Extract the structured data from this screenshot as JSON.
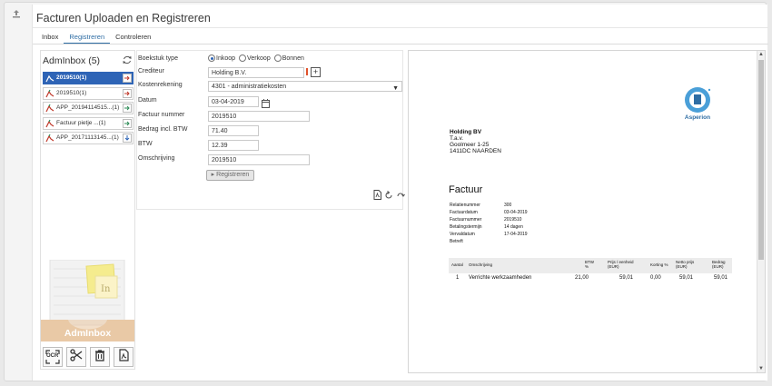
{
  "header": {
    "title": "Facturen Uploaden en Registreren",
    "upload_icon": "upload-icon"
  },
  "tabs": [
    {
      "label": "Inbox",
      "active": false
    },
    {
      "label": "Registreren",
      "active": true
    },
    {
      "label": "Controleren",
      "active": false
    }
  ],
  "inbox": {
    "title": "AdmInbox (5)",
    "items": [
      {
        "label": "2019510(1)",
        "selected": true
      },
      {
        "label": "2019510(1)",
        "selected": false
      },
      {
        "label": "APP_20194114515...(1)",
        "selected": false
      },
      {
        "label": "Factuur pietje ...(1)",
        "selected": false
      },
      {
        "label": "APP_20171113145...(1)",
        "selected": false
      }
    ],
    "tray_label": "AdmInbox",
    "tools": [
      "ocr-icon",
      "scissors-icon",
      "trash-icon",
      "pdf-icon"
    ],
    "ocr_label": "OCR"
  },
  "form": {
    "boekstuk_label": "Boekstuk type",
    "boekstuk_options": [
      "Inkoop",
      "Verkoop",
      "Bonnen"
    ],
    "boekstuk_selected": "Inkoop",
    "crediteur_label": "Crediteur",
    "crediteur_value": "Holding B.V.",
    "kostenrekening_label": "Kostenrekening",
    "kostenrekening_value": "4301 - administratiekosten",
    "datum_label": "Datum",
    "datum_value": "03-04-2019",
    "factuurnummer_label": "Factuur nummer",
    "factuurnummer_value": "2019510",
    "bedrag_label": "Bedrag incl. BTW",
    "bedrag_value": "71.40",
    "btw_label": "BTW",
    "btw_value": "12.39",
    "omschrijving_label": "Omschrijving",
    "omschrijving_value": "2019510",
    "submit_label": "Registreren"
  },
  "invoice": {
    "logo_text": "Asperion",
    "addr": [
      "Holding BV",
      "T.a.v.",
      "Goolmeer 1-25",
      "1411DC NAARDEN"
    ],
    "title": "Factuur",
    "meta": [
      {
        "k": "Relatienummer",
        "v": "300"
      },
      {
        "k": "Factuurdatum",
        "v": "03-04-2019"
      },
      {
        "k": "Factuurnummer",
        "v": "2019510"
      },
      {
        "k": "Betalingstermijn",
        "v": "14 dagen"
      },
      {
        "k": "Vervaldatum",
        "v": "17-04-2019"
      },
      {
        "k": "Betreft",
        "v": ""
      }
    ],
    "columns": [
      "Aantal",
      "Omschrijving",
      "BTW %",
      "Prijs / eenheid (EUR)",
      "Korting %",
      "Netto prijs (EUR)",
      "Bedrag (EUR)"
    ],
    "line": {
      "aantal": "1",
      "omschrijving": "Verrichte werkzaamheden",
      "btw": "21,00",
      "prijs": "59,01",
      "korting": "0,00",
      "netto": "59,01",
      "bedrag": "59,01"
    }
  }
}
